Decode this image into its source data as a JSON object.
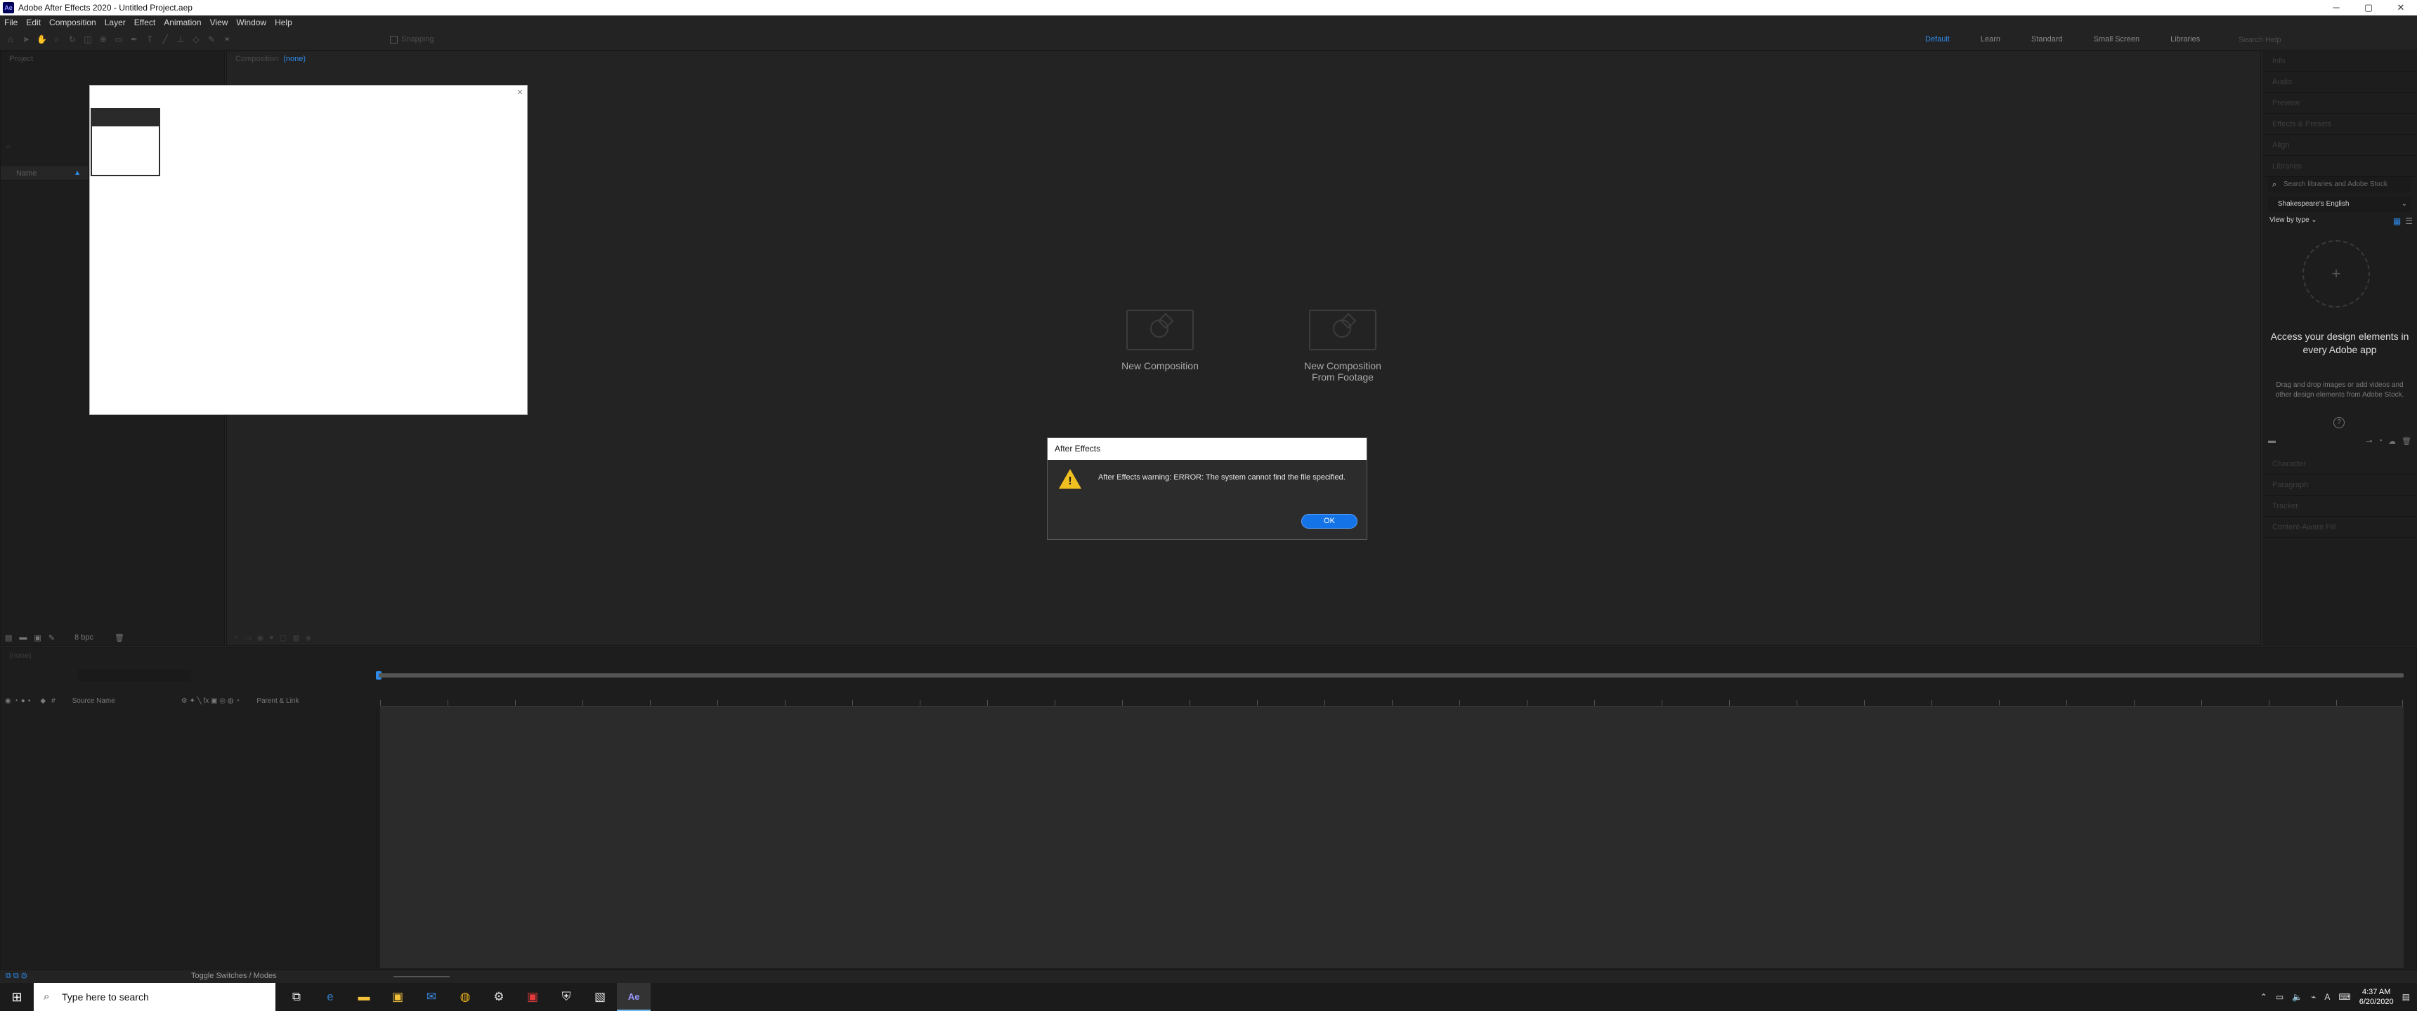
{
  "window": {
    "app_icon": "Ae",
    "title": "Adobe After Effects 2020 - Untitled Project.aep",
    "controls": [
      "─",
      "▢",
      "✕"
    ]
  },
  "menu": [
    "File",
    "Edit",
    "Composition",
    "Layer",
    "Effect",
    "Animation",
    "View",
    "Window",
    "Help"
  ],
  "toolbar": {
    "snapping_label": "Snapping",
    "workspaces": [
      "Default",
      "Learn",
      "Standard",
      "Small Screen",
      "Libraries"
    ],
    "active_workspace": "Default",
    "help_search_placeholder": "Search Help"
  },
  "project_panel": {
    "title": "Project",
    "name_column": "Name",
    "bpc": "8 bpc"
  },
  "composition_panel": {
    "title": "Composition",
    "comp_name": "(none)",
    "new_composition": "New Composition",
    "new_from_footage_line1": "New Composition",
    "new_from_footage_line2": "From Footage"
  },
  "dialog": {
    "title": "After Effects",
    "message": "After Effects warning: ERROR: The system cannot find the file specified.",
    "ok_label": "OK"
  },
  "right_panel": {
    "items_top": [
      "Info",
      "Audio",
      "Preview",
      "Effects & Presets",
      "Align",
      "Libraries"
    ],
    "library_search_placeholder": "Search libraries and Adobe Stock",
    "library_selected": "Shakespeare's English",
    "view_by_type": "View by type",
    "headline": "Access your design elements in every Adobe app",
    "subtext": "Drag and drop images or add videos and other design elements from Adobe Stock.",
    "items_bottom": [
      "Character",
      "Paragraph",
      "Tracker",
      "Content-Aware Fill"
    ]
  },
  "timeline": {
    "tab_label": "(none)",
    "source_name_col": "Source Name",
    "parent_link_col": "Parent & Link",
    "toggle_label": "Toggle Switches / Modes"
  },
  "taskbar": {
    "search_placeholder": "Type here to search",
    "time": "4:37 AM",
    "date": "6/20/2020"
  }
}
